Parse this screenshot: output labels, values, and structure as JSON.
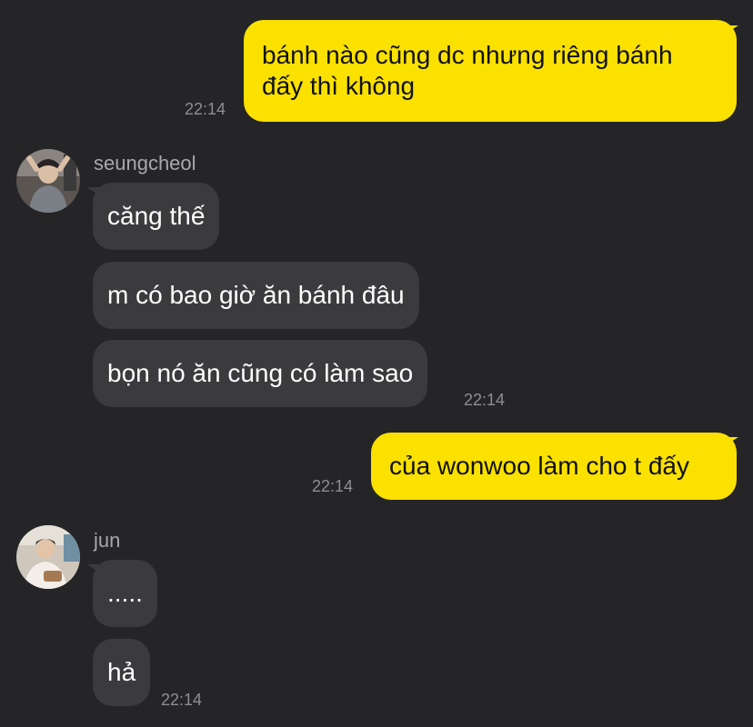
{
  "messages": [
    {
      "type": "out",
      "text": "bánh nào cũng dc nhưng riêng bánh đấy thì không",
      "time": "22:14"
    },
    {
      "type": "in_group",
      "sender": "seungcheol",
      "bubbles": [
        "căng thế",
        "m có bao giờ ăn bánh đâu",
        "bọn nó ăn cũng có làm sao"
      ],
      "time": "22:14"
    },
    {
      "type": "out",
      "text": "của wonwoo làm cho t đấy",
      "time": "22:14"
    },
    {
      "type": "in_group",
      "sender": "jun",
      "bubbles": [
        ".....",
        "hả"
      ],
      "time": "22:14"
    }
  ],
  "colors": {
    "background": "#252527",
    "outgoing_bubble": "#fae100",
    "incoming_bubble": "#3b3b3d",
    "timestamp": "#8e8e93"
  }
}
